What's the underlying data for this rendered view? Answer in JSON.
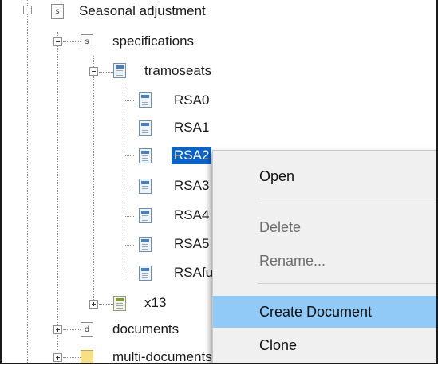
{
  "tree": {
    "seasonal_adjustment": {
      "letter": "s",
      "label": "Seasonal adjustment"
    },
    "specifications": {
      "letter": "s",
      "label": "specifications"
    },
    "tramoseats": {
      "icon": "spec-icon",
      "label": "tramoseats"
    },
    "children": [
      {
        "label": "RSA0",
        "selected": false
      },
      {
        "label": "RSA1",
        "selected": false
      },
      {
        "label": "RSA2",
        "selected": true
      },
      {
        "label": "RSA3",
        "selected": false
      },
      {
        "label": "RSA4",
        "selected": false
      },
      {
        "label": "RSA5",
        "selected": false
      },
      {
        "label": "RSAfull",
        "selected": false
      }
    ],
    "x13": {
      "icon": "spec-icon",
      "label": "x13"
    },
    "documents": {
      "letter": "d",
      "label": "documents"
    },
    "multi_documents": {
      "icon": "folder-icon",
      "label": "multi-documents"
    }
  },
  "context_menu": {
    "items": [
      {
        "label": "Open",
        "enabled": true,
        "highlighted": false
      },
      {
        "label": "Delete",
        "enabled": false,
        "highlighted": false
      },
      {
        "label": "Rename...",
        "enabled": false,
        "highlighted": false
      },
      {
        "label": "Create Document",
        "enabled": true,
        "highlighted": true
      },
      {
        "label": "Clone",
        "enabled": true,
        "highlighted": false
      }
    ]
  },
  "colors": {
    "selection": "#0a64c8",
    "menu_highlight": "#91c9f7",
    "menu_background": "#f0f0f0"
  }
}
